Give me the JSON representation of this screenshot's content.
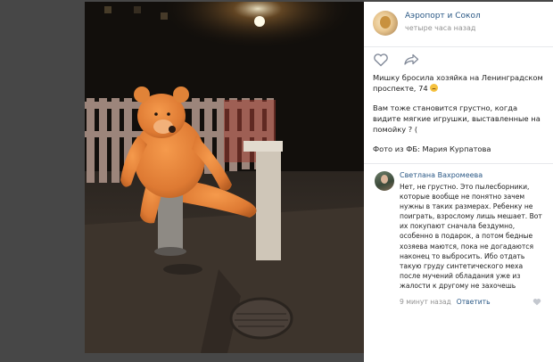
{
  "post": {
    "author": "Аэропорт и Сокол",
    "time": "четыре часа назад",
    "text_line1": "Мишку бросила хозяйка на Ленинградском проспекте, 74",
    "text_line2": "Вам тоже становится грустно, когда видите мягкие игрушки, выставленные на помойку ? (",
    "text_line3": "Фото из ФБ: Мария Курпатова"
  },
  "icons": {
    "like": "heart-outline-icon",
    "share": "share-arrow-icon",
    "emoji": "crying-face-emoji"
  },
  "comment": {
    "author": "Светлана Вахромеева",
    "text": "Нет, не грустно. Это пылесборники, которые вообще не понятно зачем нужны в таких размерах. Ребенку не поиграть, взрослому лишь мешает. Вот их покупают сначала бездумно, особенно в подарок, а потом бедные хозяева маются, пока не догадаются наконец то выбросить. Ибо отдать такую груду синтетического меха после мучений обладания уже из жалости к другому не захочешь",
    "time": "9 минут назад",
    "reply_label": "Ответить"
  },
  "colors": {
    "link": "#2a5885",
    "muted": "#939393",
    "background": "#474747"
  }
}
